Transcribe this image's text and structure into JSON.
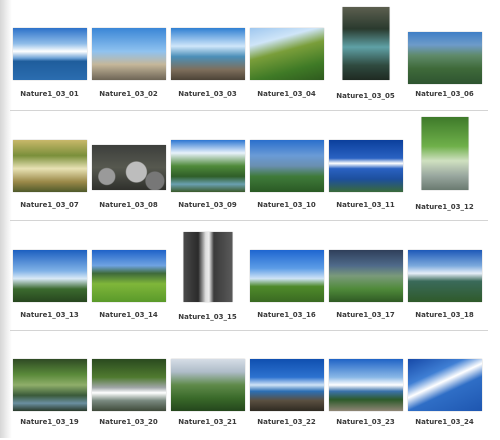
{
  "gallery": {
    "rows": [
      [
        {
          "caption": "Nature1_03_01",
          "orientation": "landscape"
        },
        {
          "caption": "Nature1_03_02",
          "orientation": "landscape"
        },
        {
          "caption": "Nature1_03_03",
          "orientation": "landscape"
        },
        {
          "caption": "Nature1_03_04",
          "orientation": "landscape"
        },
        {
          "caption": "Nature1_03_05",
          "orientation": "portrait"
        },
        {
          "caption": "Nature1_03_06",
          "orientation": "landscape"
        }
      ],
      [
        {
          "caption": "Nature1_03_07",
          "orientation": "landscape"
        },
        {
          "caption": "Nature1_03_08",
          "orientation": "landscape"
        },
        {
          "caption": "Nature1_03_09",
          "orientation": "landscape"
        },
        {
          "caption": "Nature1_03_10",
          "orientation": "landscape"
        },
        {
          "caption": "Nature1_03_11",
          "orientation": "landscape"
        },
        {
          "caption": "Nature1_03_12",
          "orientation": "portrait"
        }
      ],
      [
        {
          "caption": "Nature1_03_13",
          "orientation": "landscape"
        },
        {
          "caption": "Nature1_03_14",
          "orientation": "landscape"
        },
        {
          "caption": "Nature1_03_15",
          "orientation": "portrait"
        },
        {
          "caption": "Nature1_03_16",
          "orientation": "landscape"
        },
        {
          "caption": "Nature1_03_17",
          "orientation": "landscape"
        },
        {
          "caption": "Nature1_03_18",
          "orientation": "landscape"
        }
      ],
      [
        {
          "caption": "Nature1_03_19",
          "orientation": "landscape"
        },
        {
          "caption": "Nature1_03_20",
          "orientation": "landscape"
        },
        {
          "caption": "Nature1_03_21",
          "orientation": "landscape"
        },
        {
          "caption": "Nature1_03_22",
          "orientation": "landscape"
        },
        {
          "caption": "Nature1_03_23",
          "orientation": "landscape"
        },
        {
          "caption": "Nature1_03_24",
          "orientation": "landscape"
        }
      ]
    ]
  }
}
